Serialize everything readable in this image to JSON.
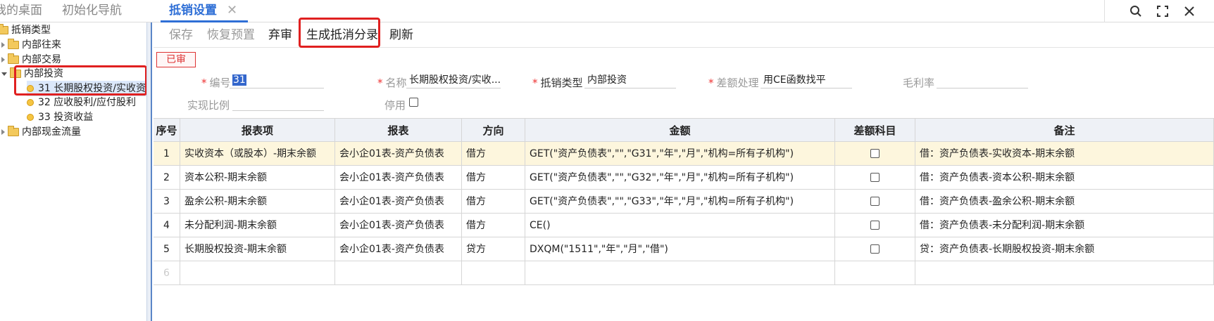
{
  "tabs": [
    {
      "label": "我的桌面"
    },
    {
      "label": "初始化导航"
    },
    {
      "label": "抵销设置"
    }
  ],
  "window_icons": [
    "search-icon",
    "maximize-icon",
    "close-icon"
  ],
  "tree": {
    "root": "抵销类型",
    "nodes": [
      {
        "label": "内部往来"
      },
      {
        "label": "内部交易"
      },
      {
        "label": "内部投资"
      },
      {
        "label": "31 长期股权投资/实收资"
      },
      {
        "label": "32 应收股利/应付股利"
      },
      {
        "label": "33 投资收益"
      },
      {
        "label": "内部现金流量"
      }
    ]
  },
  "toolbar": {
    "save": "保存",
    "restore": "恢复预置",
    "unapprove": "弃审",
    "generate": "生成抵消分录",
    "refresh": "刷新"
  },
  "status_badge": "已审",
  "form": {
    "code_label": "编号",
    "code_value": "31",
    "name_label": "名称",
    "name_value": "长期股权投资/实收...",
    "type_label": "抵销类型",
    "type_value": "内部投资",
    "diff_label": "差额处理",
    "diff_value": "用CE函数找平",
    "margin_label": "毛利率",
    "margin_value": "",
    "realize_label": "实现比例",
    "realize_value": "",
    "disable_label": "停用"
  },
  "table": {
    "headers": [
      "序号",
      "报表项",
      "报表",
      "方向",
      "金额",
      "差额科目",
      "备注"
    ],
    "rows": [
      {
        "no": "1",
        "item": "实收资本（或股本）-期末余额",
        "report": "会小企01表-资产负债表",
        "dir": "借方",
        "amount": "GET(\"资产负债表\",\"\",\"G31\",\"年\",\"月\",\"机构=所有子机构\")",
        "note": "借：资产负债表-实收资本-期末余额"
      },
      {
        "no": "2",
        "item": "资本公积-期末余额",
        "report": "会小企01表-资产负债表",
        "dir": "借方",
        "amount": "GET(\"资产负债表\",\"\",\"G32\",\"年\",\"月\",\"机构=所有子机构\")",
        "note": "借：资产负债表-资本公积-期末余额"
      },
      {
        "no": "3",
        "item": "盈余公积-期末余额",
        "report": "会小企01表-资产负债表",
        "dir": "借方",
        "amount": "GET(\"资产负债表\",\"\",\"G33\",\"年\",\"月\",\"机构=所有子机构\")",
        "note": "借：资产负债表-盈余公积-期末余额"
      },
      {
        "no": "4",
        "item": "未分配利润-期末余额",
        "report": "会小企01表-资产负债表",
        "dir": "借方",
        "amount": "CE()",
        "note": "借：资产负债表-未分配利润-期末余额"
      },
      {
        "no": "5",
        "item": "长期股权投资-期末余额",
        "report": "会小企01表-资产负债表",
        "dir": "贷方",
        "amount": "DXQM(\"1511\",\"年\",\"月\",\"借\")",
        "note": "贷：资产负债表-长期股权投资-期末余额"
      },
      {
        "no": "6",
        "item": "",
        "report": "",
        "dir": "",
        "amount": "",
        "note": ""
      }
    ]
  }
}
